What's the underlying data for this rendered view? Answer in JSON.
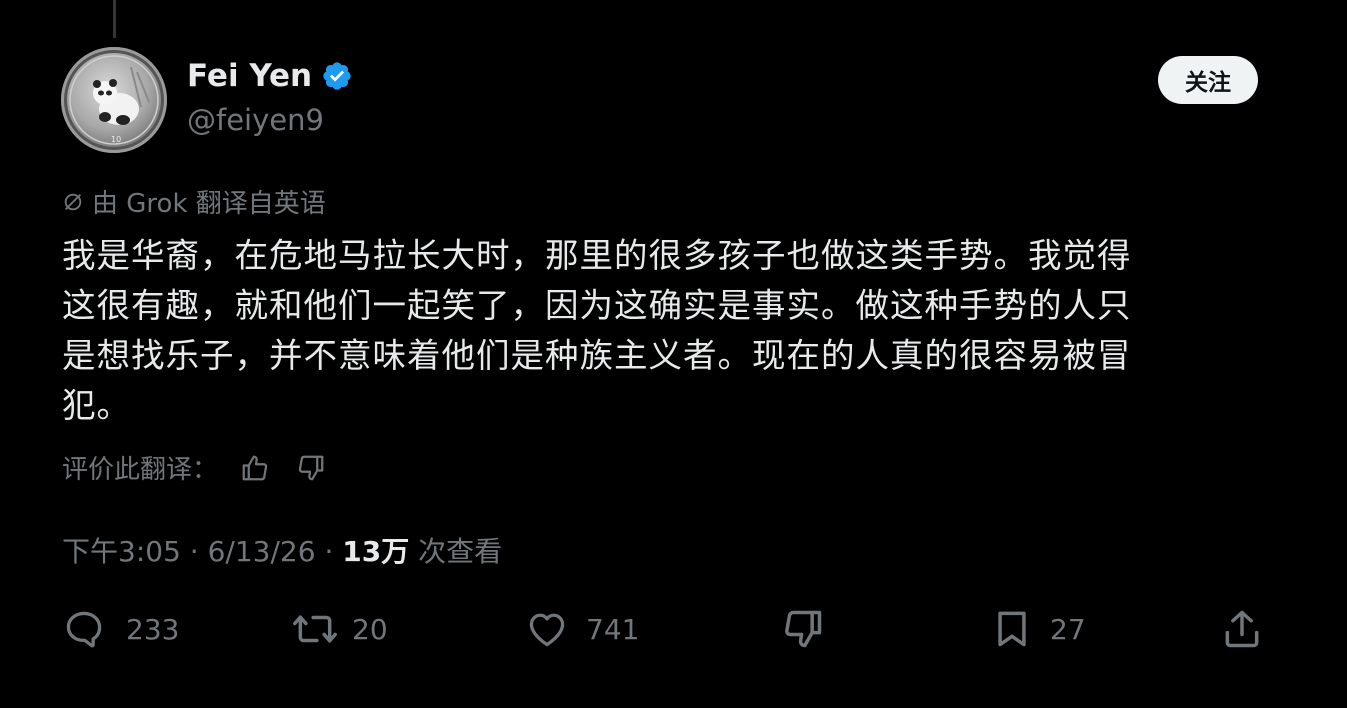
{
  "author": {
    "name": "Fei Yen",
    "handle": "@feiyen9",
    "verified": true,
    "avatar": "panda-silver-coin"
  },
  "follow_button": "关注",
  "translation_note": "由 Grok 翻译自英语",
  "tweet_lines": [
    "我是华裔，在危地马拉长大时，那里的很多孩子也做这类手势。我觉得",
    "这很有趣，就和他们一起笑了，因为这确实是事实。做这种手势的人只",
    "是想找乐子，并不意味着他们是种族主义者。现在的人真的很容易被冒",
    "犯。"
  ],
  "rate_translation": "评价此翻译：",
  "meta": {
    "time": "下午3:05",
    "date": "6/13/26",
    "separator": "·",
    "views": "13万",
    "views_label": "次查看"
  },
  "actions": {
    "replies": "233",
    "reposts": "20",
    "likes": "741",
    "bookmarks": "27"
  },
  "colors": {
    "background": "#000000",
    "text": "#e7e9ea",
    "secondary": "#71767b",
    "verified": "#1d9bf0",
    "follow_bg": "#eff3f4"
  }
}
